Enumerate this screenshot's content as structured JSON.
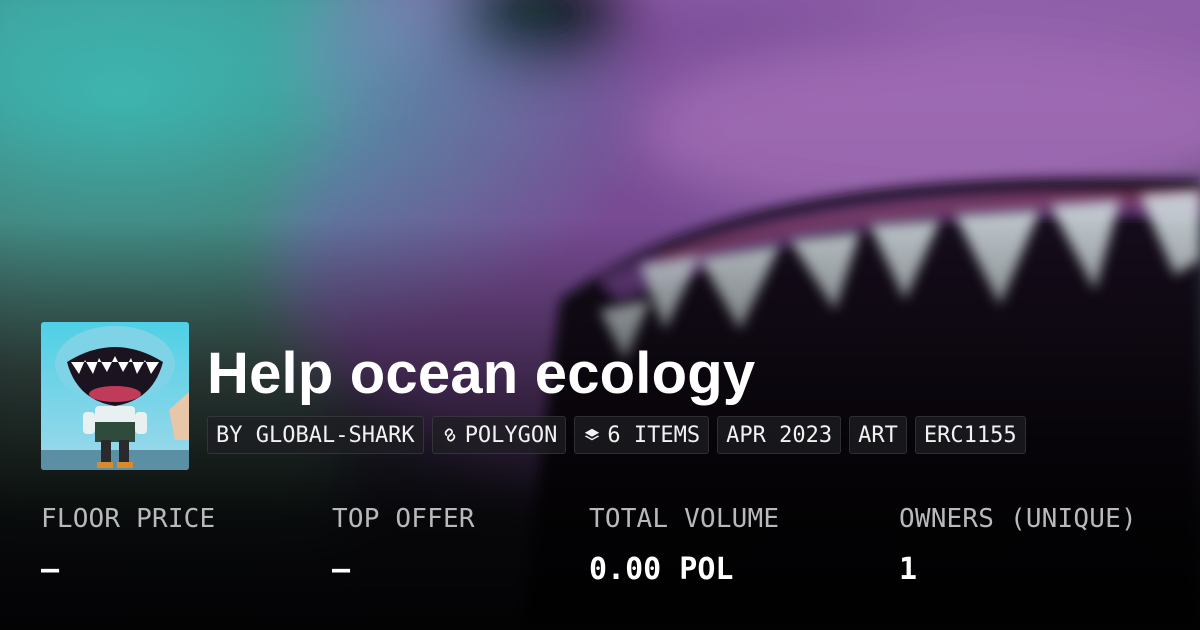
{
  "collection": {
    "title": "Help ocean ecology",
    "tags": [
      {
        "text": "BY GLOBAL-SHARK",
        "icon": ""
      },
      {
        "text": "POLYGON",
        "icon": "polygon-link-icon"
      },
      {
        "text": "6 ITEMS",
        "icon": "layers-icon"
      },
      {
        "text": "APR 2023",
        "icon": ""
      },
      {
        "text": "ART",
        "icon": ""
      },
      {
        "text": "ERC1155",
        "icon": ""
      }
    ]
  },
  "stats": {
    "floor_price": {
      "label": "FLOOR PRICE",
      "value": "–"
    },
    "top_offer": {
      "label": "TOP OFFER",
      "value": "–"
    },
    "total_volume": {
      "label": "TOTAL VOLUME",
      "value": "0.00 POL"
    },
    "owners": {
      "label": "OWNERS (UNIQUE)",
      "value": "1"
    }
  },
  "colors": {
    "background": "#0b0a10",
    "shark_purple": "#8a5aa8",
    "accent_teal": "#2ec4c4",
    "label_gray": "#b9b9bd"
  }
}
